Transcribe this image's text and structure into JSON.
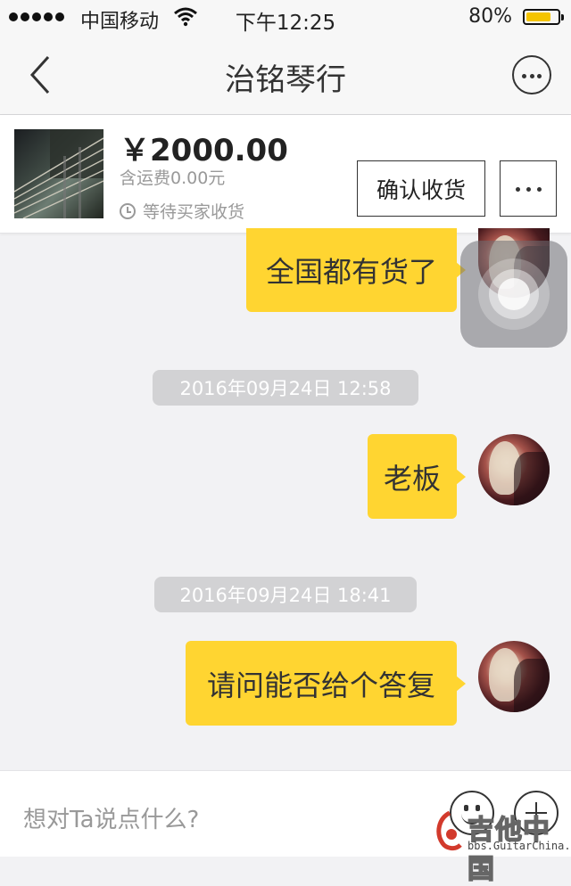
{
  "status_bar": {
    "carrier": "中国移动",
    "time": "下午12:25",
    "battery_text": "80%",
    "battery_level": 0.8,
    "icons": [
      "signal-dots-icon",
      "wifi-icon",
      "battery-icon"
    ]
  },
  "nav": {
    "title": "治铭琴行",
    "back_icon": "chevron-left-icon",
    "more_icon": "more-circle-icon"
  },
  "order": {
    "price": "￥2000.00",
    "shipping": "含运费0.00元",
    "status": "等待买家收货",
    "confirm_label": "确认收货"
  },
  "messages": [
    {
      "type": "text",
      "text": "全国都有货了"
    },
    {
      "type": "timestamp",
      "text": "2016年09月24日 12:58"
    },
    {
      "type": "text",
      "text": "老板"
    },
    {
      "type": "timestamp",
      "text": "2016年09月24日 18:41"
    },
    {
      "type": "text",
      "text": "请问能否给个答复"
    }
  ],
  "input": {
    "placeholder": "想对Ta说点什么?"
  },
  "watermark": {
    "text": "吉他中国",
    "url": "bbs.GuitarChina.com"
  },
  "colors": {
    "bubble": "#ffd531",
    "timestamp_bg": "#d2d2d4",
    "background": "#f2f2f4",
    "battery": "#f5c400"
  }
}
